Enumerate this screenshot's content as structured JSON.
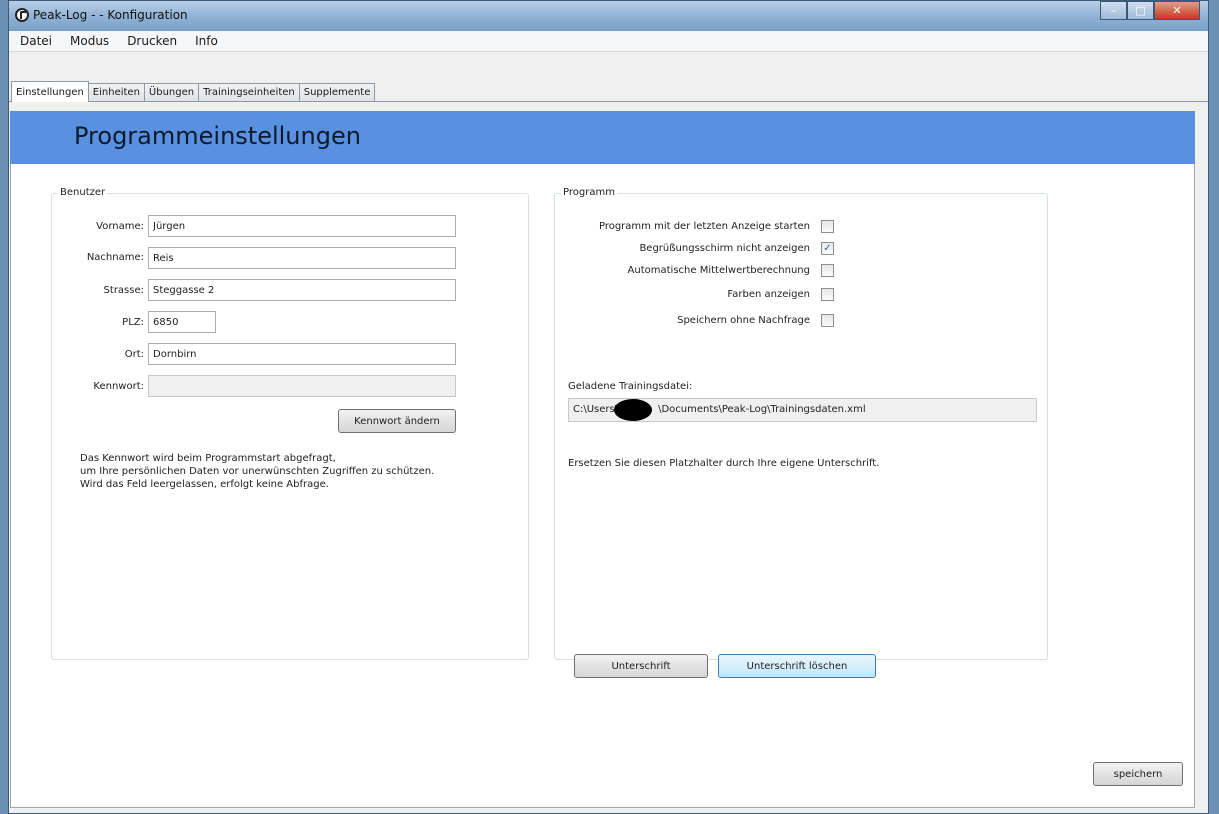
{
  "window": {
    "title": "Peak-Log -   - Konfiguration",
    "buttons": {
      "minimize": "–",
      "maximize": "□",
      "close": "✕"
    }
  },
  "menu": [
    "Datei",
    "Modus",
    "Drucken",
    "Info"
  ],
  "tabs": [
    "Einstellungen",
    "Einheiten",
    "Übungen",
    "Trainingseinheiten",
    "Supplemente"
  ],
  "header": {
    "title": "Programmeinstellungen"
  },
  "benutzer": {
    "legend": "Benutzer",
    "vorname_label": "Vorname:",
    "vorname": "Jürgen",
    "nachname_label": "Nachname:",
    "nachname": "Reis",
    "strasse_label": "Strasse:",
    "strasse": "Steggasse 2",
    "plz_label": "PLZ:",
    "plz": "6850",
    "ort_label": "Ort:",
    "ort": "Dornbirn",
    "kennwort_label": "Kennwort:",
    "kennwort": "",
    "kennwort_button": "Kennwort ändern",
    "info_lines": [
      "Das Kennwort wird beim Programmstart abgefragt,",
      "um Ihre persönlichen Daten vor unerwünschten Zugriffen zu schützen.",
      "Wird das Feld leergelassen, erfolgt keine Abfrage."
    ]
  },
  "programm": {
    "legend": "Programm",
    "options": [
      {
        "label": "Programm mit der letzten Anzeige starten",
        "checked": false
      },
      {
        "label": "Begrüßungsschirm nicht anzeigen",
        "checked": true
      },
      {
        "label": "Automatische Mittelwertberechnung",
        "checked": false
      },
      {
        "label": "Farben anzeigen",
        "checked": false
      },
      {
        "label": "Speichern ohne Nachfrage",
        "checked": false
      }
    ],
    "training_file_label": "Geladene Trainingsdatei:",
    "training_file_prefix": "C:\\Users\\",
    "training_file_suffix": "\\Documents\\Peak-Log\\Trainingsdaten.xml",
    "signature_placeholder": "Ersetzen Sie diesen Platzhalter durch Ihre eigene Unterschrift.",
    "signature_button": "Unterschrift",
    "signature_delete_button": "Unterschrift löschen"
  },
  "save_button": "speichern"
}
